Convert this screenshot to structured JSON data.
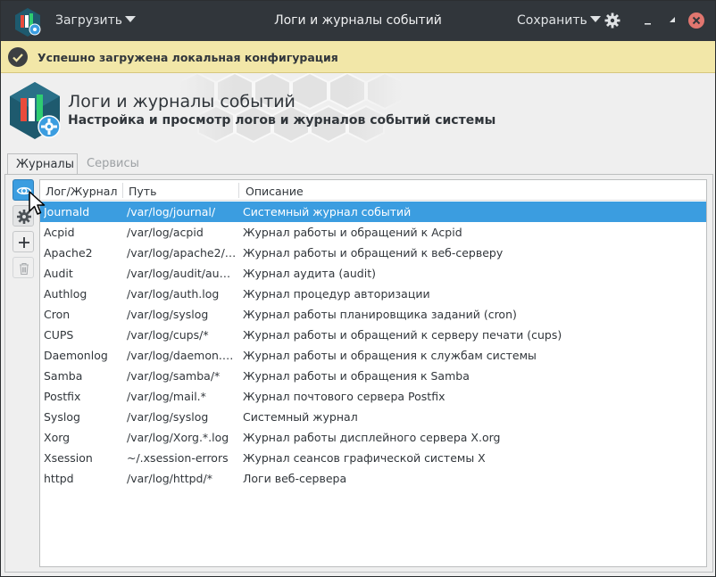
{
  "titlebar": {
    "load_label": "Загрузить",
    "title": "Логи и журналы событий",
    "save_label": "Сохранить"
  },
  "notification": {
    "text": "Успешно загружена локальная конфигурация"
  },
  "header": {
    "title": "Логи и журналы событий",
    "subtitle": "Настройка и просмотр логов и журналов событий системы"
  },
  "tabs": [
    {
      "label": "Журналы",
      "active": true
    },
    {
      "label": "Сервисы",
      "active": false
    }
  ],
  "table": {
    "columns": [
      "Лог/Журнал",
      "Путь",
      "Описание"
    ],
    "rows": [
      {
        "name": "Journald",
        "path": "/var/log/journal/",
        "desc": "Системный журнал событий",
        "selected": true
      },
      {
        "name": "Acpid",
        "path": "/var/log/acpid",
        "desc": "Журнал работы и обращений к Acpid"
      },
      {
        "name": "Apache2",
        "path": "/var/log/apache2/…",
        "desc": "Журнал работы и обращений к веб-серверу"
      },
      {
        "name": "Audit",
        "path": "/var/log/audit/au…",
        "desc": "Журнал аудита (audit)"
      },
      {
        "name": "Authlog",
        "path": "/var/log/auth.log",
        "desc": "Журнал процедур авторизации"
      },
      {
        "name": "Cron",
        "path": "/var/log/syslog",
        "desc": "Журнал работы планировщика заданий (cron)"
      },
      {
        "name": "CUPS",
        "path": "/var/log/cups/*",
        "desc": "Журнал работы и обращений к серверу печати (cups)"
      },
      {
        "name": "Daemonlog",
        "path": "/var/log/daemon.…",
        "desc": "Журнал работы и обращения к службам системы"
      },
      {
        "name": "Samba",
        "path": "/var/log/samba/*",
        "desc": "Журнал работы и обращения к Samba"
      },
      {
        "name": "Postfix",
        "path": "/var/log/mail.*",
        "desc": "Журнал почтового сервера Postfix"
      },
      {
        "name": "Syslog",
        "path": "/var/log/syslog",
        "desc": "Системный журнал"
      },
      {
        "name": "Xorg",
        "path": "/var/log/Xorg.*.log",
        "desc": "Журнал работы дисплейного сервера X.org"
      },
      {
        "name": "Xsession",
        "path": "~/.xsession-errors",
        "desc": "Журнал сеансов графической системы X"
      },
      {
        "name": "httpd",
        "path": "/var/log/httpd/*",
        "desc": "Логи веб-сервера"
      }
    ]
  },
  "icons": {
    "app": "app-logo-icon",
    "view": "eye-icon",
    "configure": "gear-icon",
    "add": "plus-icon",
    "delete": "trash-icon",
    "notify": "checkmark-icon"
  },
  "colors": {
    "titlebar": "#31363b",
    "accent": "#3b9de0",
    "notification_bg": "#f2e7a8",
    "close": "#e1766f"
  }
}
